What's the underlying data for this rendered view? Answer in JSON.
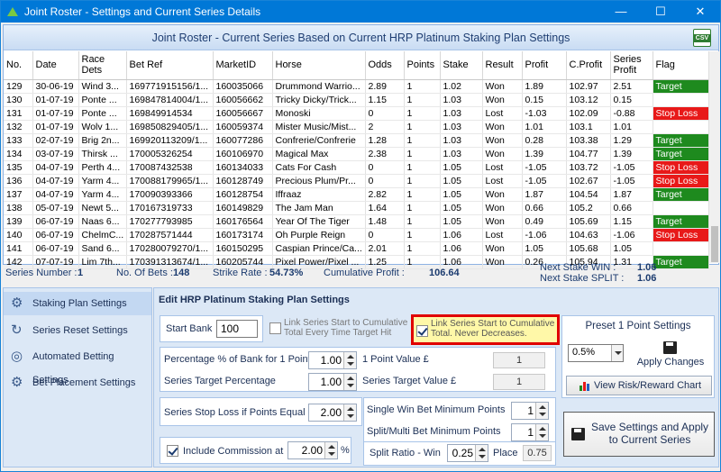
{
  "window": {
    "title": "Joint Roster - Settings and Current Series Details",
    "minimize": "—",
    "maximize": "☐",
    "close": "✕"
  },
  "grid": {
    "title": "Joint Roster - Current Series Based on Current HRP Platinum Staking Plan Settings",
    "csv_label": "CSV",
    "columns": [
      "No.",
      "Date",
      "Race Dets",
      "Bet Ref",
      "MarketID",
      "Horse",
      "Odds",
      "Points",
      "Stake",
      "Result",
      "Profit",
      "C.Profit",
      "Series Profit",
      "Flag"
    ],
    "rows": [
      [
        "129",
        "30-06-19",
        "Wind 3...",
        "169771915156/1...",
        "160035066",
        "Drummond Warrio...",
        "2.89",
        "1",
        "1.02",
        "Won",
        "1.89",
        "102.97",
        "2.51",
        "Target"
      ],
      [
        "130",
        "01-07-19",
        "Ponte ...",
        "169847814004/1...",
        "160056662",
        "Tricky Dicky/Trick...",
        "1.15",
        "1",
        "1.03",
        "Won",
        "0.15",
        "103.12",
        "0.15",
        ""
      ],
      [
        "131",
        "01-07-19",
        "Ponte ...",
        "169849914534",
        "160056667",
        "Monoski",
        "0",
        "1",
        "1.03",
        "Lost",
        "-1.03",
        "102.09",
        "-0.88",
        "Stop Loss"
      ],
      [
        "132",
        "01-07-19",
        "Wolv 1...",
        "169850829405/1...",
        "160059374",
        "Mister Music/Mist...",
        "2",
        "1",
        "1.03",
        "Won",
        "1.01",
        "103.1",
        "1.01",
        ""
      ],
      [
        "133",
        "02-07-19",
        "Brig 2n...",
        "169920113209/1...",
        "160077286",
        "Confrerie/Confrerie",
        "1.28",
        "1",
        "1.03",
        "Won",
        "0.28",
        "103.38",
        "1.29",
        "Target"
      ],
      [
        "134",
        "03-07-19",
        "Thirsk ...",
        "170005326254",
        "160106970",
        "Magical Max",
        "2.38",
        "1",
        "1.03",
        "Won",
        "1.39",
        "104.77",
        "1.39",
        "Target"
      ],
      [
        "135",
        "04-07-19",
        "Perth 4...",
        "170087432538",
        "160134033",
        "Cats For Cash",
        "0",
        "1",
        "1.05",
        "Lost",
        "-1.05",
        "103.72",
        "-1.05",
        "Stop Loss"
      ],
      [
        "136",
        "04-07-19",
        "Yarm 4...",
        "170088179965/1...",
        "160128749",
        "Precious Plum/Pr...",
        "0",
        "1",
        "1.05",
        "Lost",
        "-1.05",
        "102.67",
        "-1.05",
        "Stop Loss"
      ],
      [
        "137",
        "04-07-19",
        "Yarm 4...",
        "170090393366",
        "160128754",
        "Iffraaz",
        "2.82",
        "1",
        "1.05",
        "Won",
        "1.87",
        "104.54",
        "1.87",
        "Target"
      ],
      [
        "138",
        "05-07-19",
        "Newt 5...",
        "170167319733",
        "160149829",
        "The Jam Man",
        "1.64",
        "1",
        "1.05",
        "Won",
        "0.66",
        "105.2",
        "0.66",
        ""
      ],
      [
        "139",
        "06-07-19",
        "Naas 6...",
        "170277793985",
        "160176564",
        "Year Of The Tiger",
        "1.48",
        "1",
        "1.05",
        "Won",
        "0.49",
        "105.69",
        "1.15",
        "Target"
      ],
      [
        "140",
        "06-07-19",
        "ChelmC...",
        "170287571444",
        "160173174",
        "Oh Purple Reign",
        "0",
        "1",
        "1.06",
        "Lost",
        "-1.06",
        "104.63",
        "-1.06",
        "Stop Loss"
      ],
      [
        "141",
        "06-07-19",
        "Sand 6...",
        "170280079270/1...",
        "160150295",
        "Caspian Prince/Ca...",
        "2.01",
        "1",
        "1.06",
        "Won",
        "1.05",
        "105.68",
        "1.05",
        ""
      ],
      [
        "142",
        "07-07-19",
        "Lim 7th...",
        "170391313674/1...",
        "160205744",
        "Pixel Power/Pixel ...",
        "1.25",
        "1",
        "1.06",
        "Won",
        "0.26",
        "105.94",
        "1.31",
        "Target"
      ]
    ]
  },
  "summary": {
    "series_number_label": "Series Number :",
    "series_number": "1",
    "bets_label": "No. Of Bets :",
    "bets": "148",
    "strike_label": "Strike Rate :",
    "strike": "54.73%",
    "cum_label": "Cumulative Profit :",
    "cum": "106.64",
    "next_win_label": "Next Stake WIN :",
    "next_win": "1.06",
    "next_split_label": "Next Stake SPLIT :",
    "next_split": "1.06"
  },
  "sidebar": {
    "items": [
      {
        "label": "Staking Plan Settings",
        "icon": "gear-icon"
      },
      {
        "label": "Series Reset Settings",
        "icon": "refresh-icon"
      },
      {
        "label": "Automated Betting Settings",
        "icon": "globe-icon"
      },
      {
        "label": "Bet Placement Settings",
        "icon": "gears-icon"
      }
    ]
  },
  "settings": {
    "header": "Edit HRP Platinum Staking Plan Settings",
    "start_bank_label": "Start Bank",
    "start_bank": "100",
    "link_cum_label": "Link Series Start to Cumulative Total Every Time Target Hit",
    "link_never_label": "Link Series Start to Cumulative Total. Never Decreases.",
    "pct_bank_label": "Percentage % of Bank for 1 Point",
    "pct_bank": "1.00",
    "point_value_label": "1 Point Value £",
    "point_value": "1",
    "series_target_pct_label": "Series Target Percentage",
    "series_target_pct": "1.00",
    "series_target_value_label": "Series Target Value £",
    "series_target_value": "1",
    "stop_loss_label": "Series Stop Loss if Points Equal",
    "stop_loss": "2.00",
    "single_win_label": "Single Win Bet Minimum Points",
    "single_win": "1",
    "split_multi_label": "Split/Multi  Bet Minimum Points",
    "split_multi": "1",
    "commission_label": "Include Commission at",
    "commission": "2.00",
    "commission_unit": "%",
    "split_ratio_label": "Split Ratio -  Win",
    "split_ratio_win": "0.25",
    "place_label": "Place",
    "place": "0.75",
    "preset_label": "Preset 1 Point Settings",
    "preset_value": "0.5%",
    "apply_label": "Apply Changes",
    "view_risk_label": "View Risk/Reward Chart",
    "save_label": "Save Settings and Apply to Current Series"
  },
  "colors": {
    "target": "#1e8a1e",
    "stop_loss": "#e81919",
    "highlight_border": "#e00000",
    "highlight_fill": "#fff8a8"
  }
}
